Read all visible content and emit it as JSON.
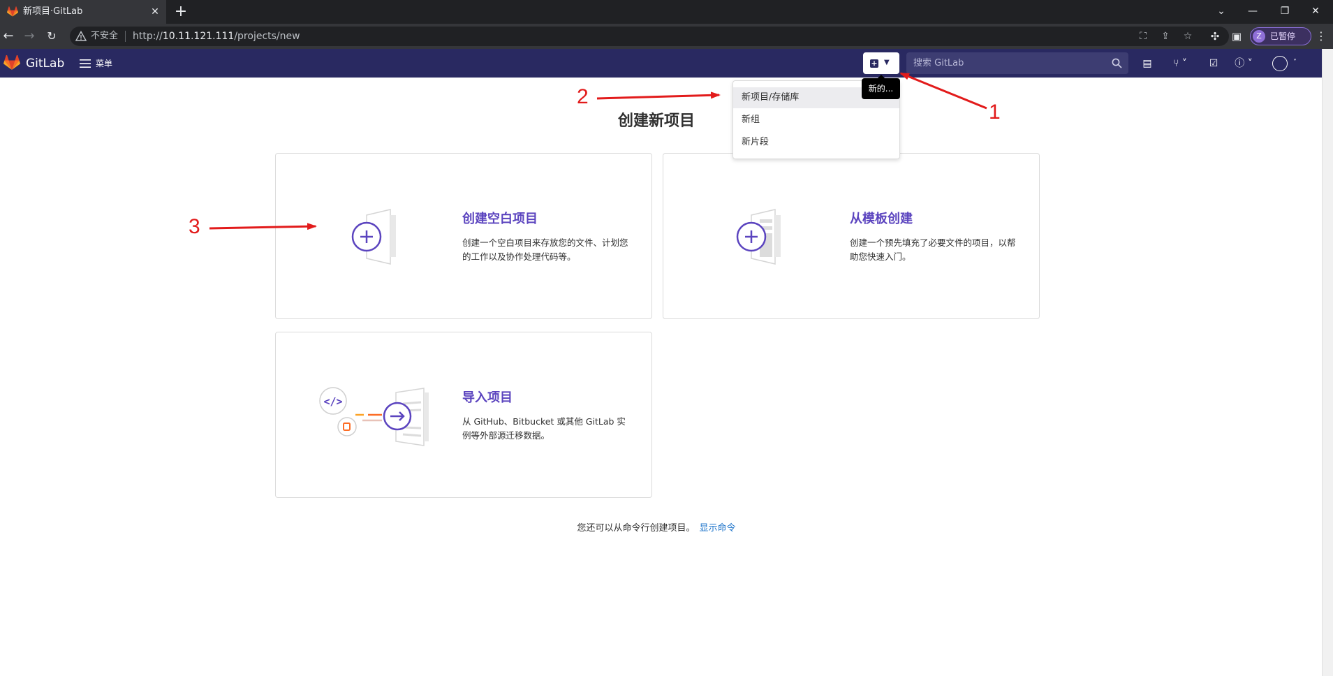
{
  "browser": {
    "tab_title": "新项目·GitLab",
    "security_label": "不安全",
    "url_prefix": "http://",
    "url_host": "10.11.121.111",
    "url_path": "/projects/new",
    "profile_initial": "Z",
    "profile_label": "已暂停"
  },
  "header": {
    "brand": "GitLab",
    "menu_label": "菜单",
    "search_placeholder": "搜索 GitLab"
  },
  "new_dropdown": {
    "tooltip": "新的...",
    "items": [
      {
        "label": "新项目/存储库"
      },
      {
        "label": "新组"
      },
      {
        "label": "新片段"
      }
    ]
  },
  "page": {
    "title": "创建新项目",
    "cards": [
      {
        "title": "创建空白项目",
        "description": "创建一个空白项目来存放您的文件、计划您的工作以及协作处理代码等。"
      },
      {
        "title": "从模板创建",
        "description": "创建一个预先填充了必要文件的项目，以帮助您快速入门。"
      },
      {
        "title": "导入项目",
        "description": "从 GitHub、Bitbucket 或其他 GitLab 实例等外部源迁移数据。"
      }
    ],
    "cli_hint": "您还可以从命令行创建项目。",
    "cli_link": "显示命令"
  },
  "annotations": [
    "1",
    "2",
    "3"
  ],
  "colors": {
    "header_bg": "#292961",
    "accent": "#5b44bf",
    "link": "#1f75cb",
    "annotation": "#e21b1b"
  }
}
